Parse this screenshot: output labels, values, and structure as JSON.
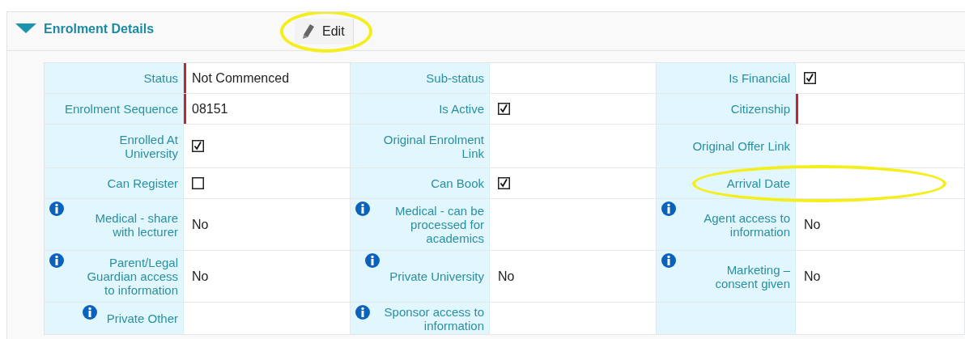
{
  "section": {
    "title": "Enrolment Details",
    "expanded": true,
    "edit_button": {
      "label": "Edit",
      "circled": true
    }
  },
  "rows": [
    [
      {
        "kind": "text",
        "label": "Status",
        "value": "Not Commenced",
        "required": true
      },
      {
        "kind": "text",
        "label": "Sub-status"
      },
      {
        "kind": "checkbox",
        "label": "Is Financial",
        "checked": true
      }
    ],
    [
      {
        "kind": "text",
        "label": "Enrolment Sequence",
        "value": "08151",
        "required": true
      },
      {
        "kind": "checkbox",
        "label": "Is Active",
        "checked": true
      },
      {
        "kind": "text",
        "label": "Citizenship",
        "required": true
      }
    ],
    [
      {
        "kind": "checkbox",
        "label": "Enrolled At University",
        "checked": true
      },
      {
        "kind": "text",
        "label": "Original Enrolment Link"
      },
      {
        "kind": "text",
        "label": "Original Offer Link"
      }
    ],
    [
      {
        "kind": "checkbox",
        "label": "Can Register",
        "checked": false
      },
      {
        "kind": "checkbox",
        "label": "Can Book",
        "checked": true
      },
      {
        "kind": "text",
        "label": "Arrival Date",
        "circled": true
      }
    ],
    [
      {
        "kind": "text",
        "label": "Medical - share with lecturer",
        "value": "No",
        "info": true
      },
      {
        "kind": "text",
        "label": "Medical - can be processed for academics",
        "info": true
      },
      {
        "kind": "text",
        "label": "Agent access to information",
        "value": "No",
        "info": true
      }
    ],
    [
      {
        "kind": "text",
        "label": "Parent/Legal Guardian access to information",
        "value": "No",
        "info": true
      },
      {
        "kind": "text",
        "label": "Private University",
        "value": "No",
        "info": true
      },
      {
        "kind": "text",
        "label": "Marketing – consent given",
        "value": "No",
        "info": true
      }
    ],
    [
      {
        "kind": "text",
        "label": "Private Other",
        "info": true
      },
      {
        "kind": "text",
        "label": "Sponsor access to information",
        "info": true
      },
      {
        "kind": "blank"
      }
    ]
  ]
}
